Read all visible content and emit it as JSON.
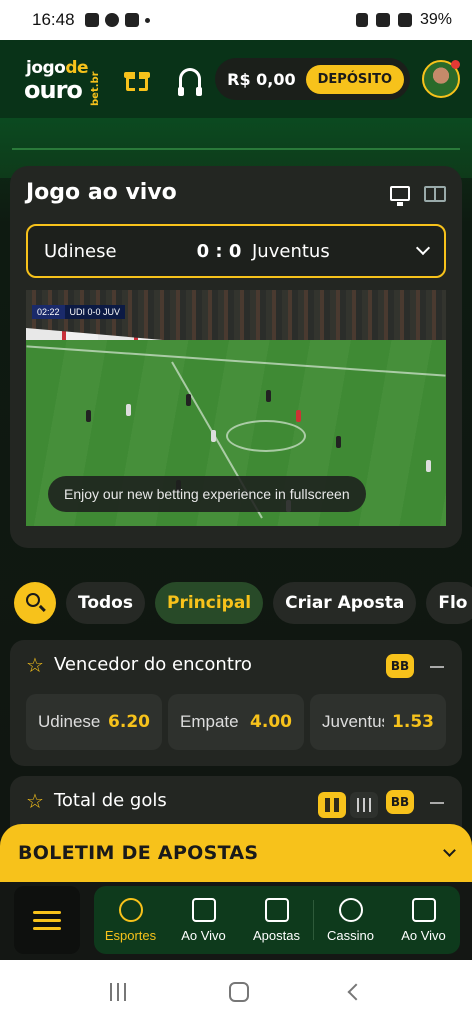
{
  "status_bar": {
    "time": "16:48",
    "battery": "39%"
  },
  "header": {
    "logo_line1_a": "jogo",
    "logo_line1_b": "de",
    "logo_line2": "ouro",
    "logo_domain": "bet.br",
    "balance": "R$ 0,00",
    "deposit_label": "DEPÓSITO"
  },
  "live": {
    "title": "Jogo ao vivo",
    "home_team": "Udinese",
    "score": "0 : 0",
    "away_team": "Juventus",
    "video_clock": "02:22",
    "video_scoreline": "UDI 0-0 JUV",
    "fullscreen_tip": "Enjoy our new betting experience in fullscreen"
  },
  "filters": {
    "chips": [
      {
        "label": "Todos",
        "active": false
      },
      {
        "label": "Principal",
        "active": true
      },
      {
        "label": "Criar Aposta",
        "active": false
      },
      {
        "label": "Flo",
        "active": false
      }
    ]
  },
  "markets": [
    {
      "title": "Vencedor do encontro",
      "badge": "BB",
      "odds": [
        {
          "name": "Udinese",
          "value": "6.20"
        },
        {
          "name": "Empate",
          "value": "4.00"
        },
        {
          "name": "Juventus",
          "value": "1.53"
        }
      ]
    },
    {
      "title": "Total de gols",
      "badge": "BB"
    }
  ],
  "betslip": {
    "title": "BOLETIM DE APOSTAS"
  },
  "bottom_nav": {
    "items": [
      {
        "label": "Esportes",
        "icon": "soccer-ball-icon",
        "active": true
      },
      {
        "label": "Ao Vivo",
        "icon": "live-pitch-icon",
        "active": false
      },
      {
        "label": "Apostas",
        "icon": "ticket-icon",
        "active": false
      },
      {
        "label": "Cassino",
        "icon": "casino-chip-icon",
        "active": false
      },
      {
        "label": "Ao Vivo",
        "icon": "cards-icon",
        "active": false
      }
    ]
  },
  "colors": {
    "accent": "#f7c21b",
    "brand_green": "#093318",
    "card": "#232622"
  }
}
